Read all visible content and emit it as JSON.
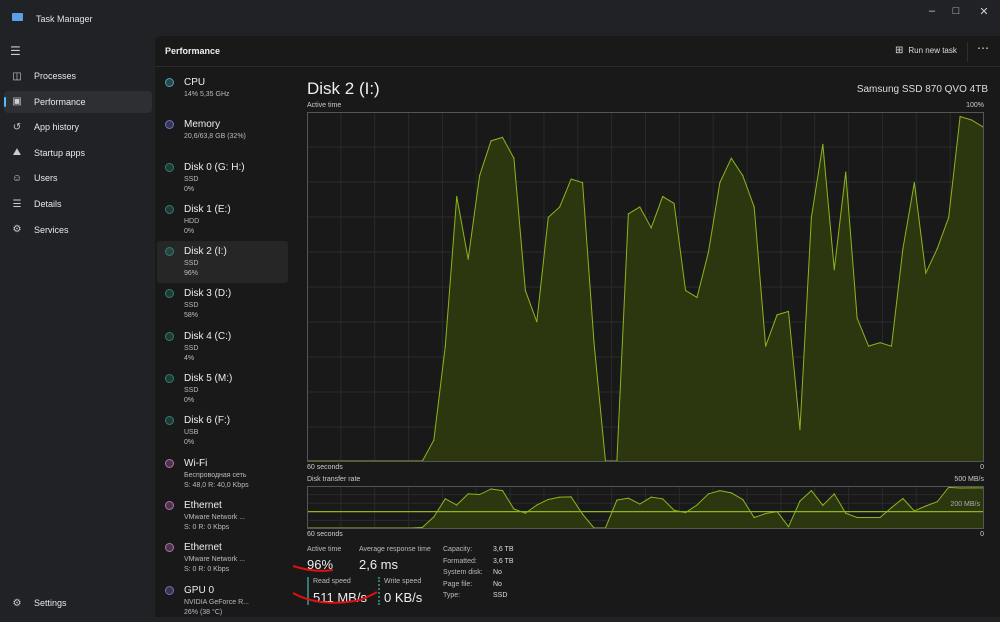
{
  "window": {
    "title": "Task Manager",
    "icon": "task-manager-icon"
  },
  "nav": {
    "items": [
      {
        "label": "Processes",
        "icon": "processes-icon",
        "selected": false
      },
      {
        "label": "Performance",
        "icon": "performance-icon",
        "selected": true
      },
      {
        "label": "App history",
        "icon": "history-icon",
        "selected": false
      },
      {
        "label": "Startup apps",
        "icon": "startup-icon",
        "selected": false
      },
      {
        "label": "Users",
        "icon": "users-icon",
        "selected": false
      },
      {
        "label": "Details",
        "icon": "details-icon",
        "selected": false
      },
      {
        "label": "Services",
        "icon": "services-icon",
        "selected": false
      }
    ],
    "settings": "Settings"
  },
  "header": {
    "title": "Performance",
    "run_new_task": "Run new task"
  },
  "devices": [
    {
      "name": "CPU",
      "sub1": "14%  5,35 GHz",
      "sub2": "",
      "color": "#4ba3b5"
    },
    {
      "name": "Memory",
      "sub1": "20,6/63,8 GB (32%)",
      "sub2": "",
      "color": "#6f73c9"
    },
    {
      "name": "Disk 0 (G: H:)",
      "sub1": "SSD",
      "sub2": "0%",
      "color": "#2f7d70"
    },
    {
      "name": "Disk 1 (E:)",
      "sub1": "HDD",
      "sub2": "0%",
      "color": "#2f7d70"
    },
    {
      "name": "Disk 2 (I:)",
      "sub1": "SSD",
      "sub2": "96%",
      "color": "#2f7d70",
      "selected": true
    },
    {
      "name": "Disk 3 (D:)",
      "sub1": "SSD",
      "sub2": "58%",
      "color": "#2f7d70"
    },
    {
      "name": "Disk 4 (C:)",
      "sub1": "SSD",
      "sub2": "4%",
      "color": "#2f7d70"
    },
    {
      "name": "Disk 5 (M:)",
      "sub1": "SSD",
      "sub2": "0%",
      "color": "#2f7d70"
    },
    {
      "name": "Disk 6 (F:)",
      "sub1": "USB",
      "sub2": "0%",
      "color": "#2f7d70"
    },
    {
      "name": "Wi-Fi",
      "sub1": "Беспроводная сеть",
      "sub2": "S: 48,0  R: 40,0 Kbps",
      "color": "#b46fb0"
    },
    {
      "name": "Ethernet",
      "sub1": "VMware Network ...",
      "sub2": "S: 0  R: 0 Kbps",
      "color": "#b46fb0"
    },
    {
      "name": "Ethernet",
      "sub1": "VMware Network ...",
      "sub2": "S: 0  R: 0 Kbps",
      "color": "#b46fb0"
    },
    {
      "name": "GPU 0",
      "sub1": "NVIDIA GeForce R...",
      "sub2": "26%  (38 °C)",
      "color": "#7a6bc0"
    }
  ],
  "detail": {
    "title": "Disk 2 (I:)",
    "model": "Samsung SSD 870 QVO 4TB",
    "stats": {
      "active_time_label": "Active time",
      "active_time": "96%",
      "avg_resp_label": "Average response time",
      "avg_resp": "2,6 ms",
      "read_label": "Read speed",
      "read": "511 MB/s",
      "write_label": "Write speed",
      "write": "0 KB/s"
    },
    "props": [
      {
        "k": "Capacity:",
        "v": "3,6 TB"
      },
      {
        "k": "Formatted:",
        "v": "3,6 TB"
      },
      {
        "k": "System disk:",
        "v": "No"
      },
      {
        "k": "Page file:",
        "v": "No"
      },
      {
        "k": "Type:",
        "v": "SSD"
      }
    ]
  },
  "colors": {
    "line": "#8cb51e",
    "fill": "#2c3710",
    "grid": "#2a2a2a",
    "border": "#555555",
    "annotation": "#e01010"
  },
  "chart_data": [
    {
      "type": "area",
      "title": "Active time",
      "xlabel": "60 seconds",
      "x_end_label": "0",
      "ymax_label": "100%",
      "ylim": [
        0,
        100
      ],
      "grid": true,
      "values": [
        0,
        0,
        0,
        0,
        0,
        0,
        0,
        0,
        0,
        0,
        0,
        6,
        33,
        76,
        58,
        82,
        92,
        93,
        87,
        49,
        40,
        70,
        73,
        81,
        80,
        34,
        0,
        0,
        71,
        73,
        67,
        76,
        74,
        49,
        47,
        60,
        80,
        87,
        82,
        73,
        33,
        42,
        43,
        9,
        70,
        91,
        55,
        83,
        41,
        33,
        34,
        33,
        61,
        80,
        54,
        61,
        70,
        99,
        98,
        96
      ]
    },
    {
      "type": "area",
      "title": "Disk transfer rate",
      "xlabel": "60 seconds",
      "x_end_label": "0",
      "ymax_label": "500 MB/s",
      "ref_label": "200 MB/s",
      "ref_value": 200,
      "ylim": [
        0,
        500
      ],
      "grid": true,
      "values": [
        0,
        0,
        0,
        0,
        0,
        0,
        0,
        0,
        0,
        0,
        8,
        136,
        356,
        280,
        416,
        408,
        476,
        456,
        232,
        180,
        280,
        348,
        376,
        380,
        168,
        0,
        0,
        340,
        364,
        292,
        376,
        356,
        216,
        188,
        280,
        416,
        456,
        428,
        348,
        128,
        176,
        200,
        16,
        328,
        456,
        276,
        416,
        180,
        128,
        128,
        128,
        248,
        360,
        208,
        268,
        320,
        496,
        488,
        490,
        490
      ]
    }
  ]
}
